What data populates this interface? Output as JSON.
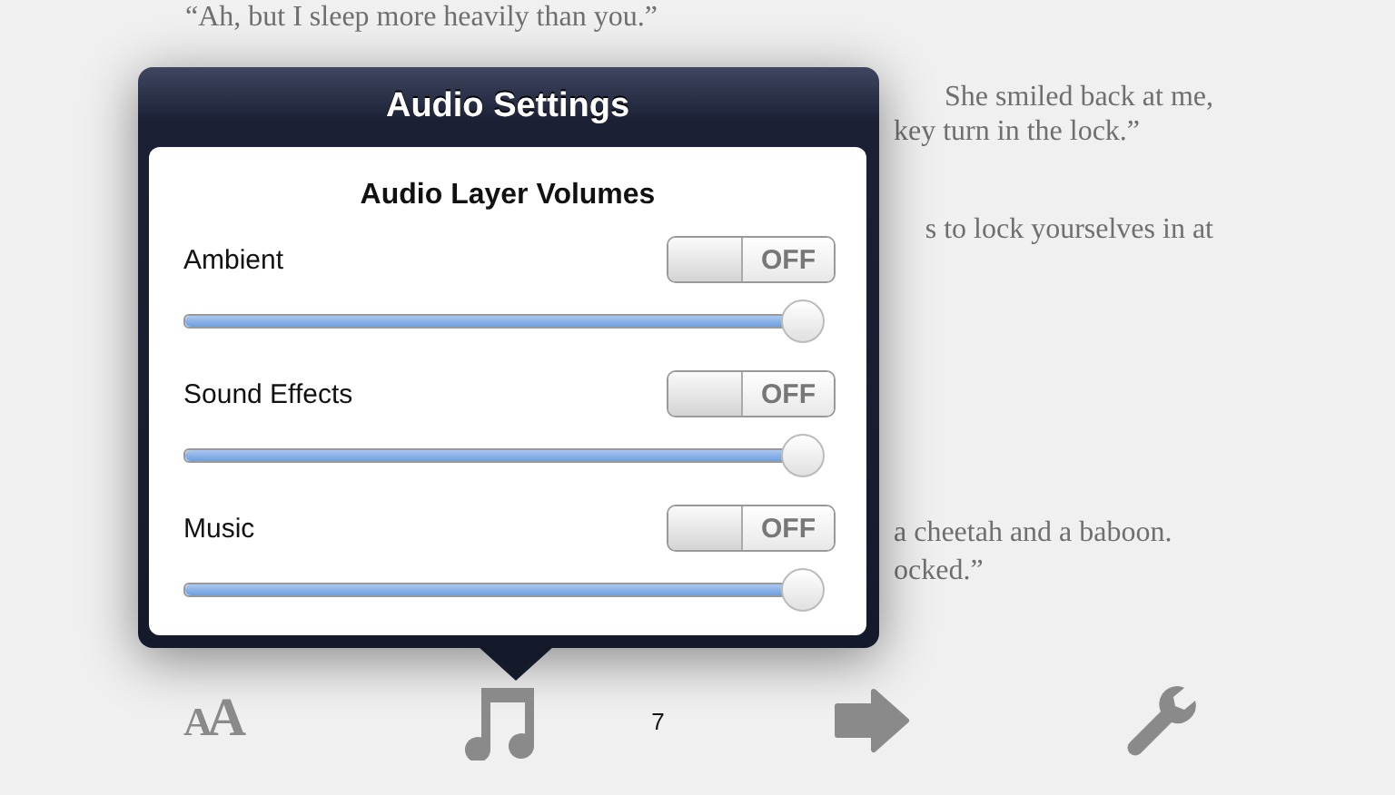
{
  "book_text": [
    {
      "text": "“Ah, but I sleep more heavily than you.”"
    },
    {
      "text": "She smiled back at me,"
    },
    {
      "text": "key turn in the lock.”"
    },
    {
      "text": "s to lock yourselves in at"
    },
    {
      "text": "a cheetah and a baboon."
    },
    {
      "text": "ocked.”"
    }
  ],
  "popover": {
    "title": "Audio Settings",
    "heading": "Audio Layer Volumes",
    "layers": [
      {
        "name": "Ambient",
        "on": false,
        "toggle_text": "OFF",
        "level": 1.0
      },
      {
        "name": "Sound Effects",
        "on": false,
        "toggle_text": "OFF",
        "level": 1.0
      },
      {
        "name": "Music",
        "on": false,
        "toggle_text": "OFF",
        "level": 1.0
      }
    ]
  },
  "toolbar": {
    "font_button": "AA",
    "page_number": "7"
  }
}
